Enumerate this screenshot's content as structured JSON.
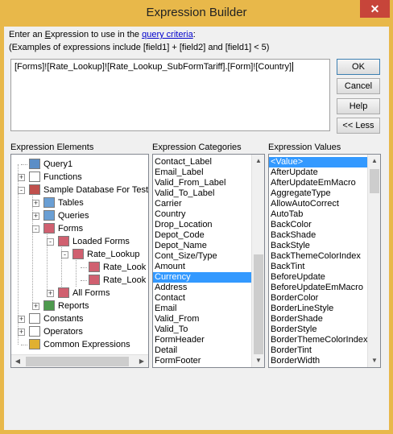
{
  "window": {
    "title": "Expression Builder",
    "close_glyph": "✕"
  },
  "instructions": {
    "line1_pre": "Enter an ",
    "line1_underlined": "E",
    "line1_mid": "xpression to use in the ",
    "line1_link": "query criteria",
    "line1_post": ":",
    "line2": "(Examples of expressions include [field1] + [field2] and [field1] < 5)"
  },
  "expression": "[Forms]![Rate_Lookup]![Rate_Lookup_SubFormTariff].[Form]![Country]",
  "buttons": {
    "ok": "OK",
    "cancel": "Cancel",
    "help": "Help",
    "less": "<< Less"
  },
  "headers": {
    "elements": "Expression Elements",
    "categories": "Expression Categories",
    "values": "Expression Values"
  },
  "tree": [
    {
      "label": "Query1",
      "icon": "query-icon"
    },
    {
      "label": "Functions",
      "icon": "functions-icon"
    },
    {
      "label": "Sample Database For Test",
      "icon": "database-icon"
    },
    {
      "label": "Tables",
      "icon": "tables-icon"
    },
    {
      "label": "Queries",
      "icon": "queries-icon"
    },
    {
      "label": "Forms",
      "icon": "forms-icon"
    },
    {
      "label": "Loaded Forms",
      "icon": "form-icon"
    },
    {
      "label": "Rate_Lookup",
      "icon": "form-icon"
    },
    {
      "label": "Rate_Look",
      "icon": "form-icon"
    },
    {
      "label": "Rate_Look",
      "icon": "form-icon"
    },
    {
      "label": "All Forms",
      "icon": "form-icon"
    },
    {
      "label": "Reports",
      "icon": "reports-icon"
    },
    {
      "label": "Constants",
      "icon": "constants-icon"
    },
    {
      "label": "Operators",
      "icon": "operators-icon"
    },
    {
      "label": "Common Expressions",
      "icon": "common-expressions-icon"
    }
  ],
  "categories": [
    "Contact_Label",
    "Email_Label",
    "Valid_From_Label",
    "Valid_To_Label",
    "Carrier",
    "Country",
    "Drop_Location",
    "Depot_Code",
    "Depot_Name",
    "Cont_Size/Type",
    "Amount",
    "Currency",
    "Address",
    "Contact",
    "Email",
    "Valid_From",
    "Valid_To",
    "FormHeader",
    "Detail",
    "FormFooter"
  ],
  "categories_selected": 11,
  "values": [
    "<Value>",
    "AfterUpdate",
    "AfterUpdateEmMacro",
    "AggregateType",
    "AllowAutoCorrect",
    "AutoTab",
    "BackColor",
    "BackShade",
    "BackStyle",
    "BackThemeColorIndex",
    "BackTint",
    "BeforeUpdate",
    "BeforeUpdateEmMacro",
    "BorderColor",
    "BorderLineStyle",
    "BorderShade",
    "BorderStyle",
    "BorderThemeColorIndex",
    "BorderTint",
    "BorderWidth"
  ],
  "values_selected": 0,
  "colors": {
    "titlebar": "#e8b84a",
    "selection": "#3399ff",
    "link": "#0000cc",
    "close": "#c7453a"
  }
}
